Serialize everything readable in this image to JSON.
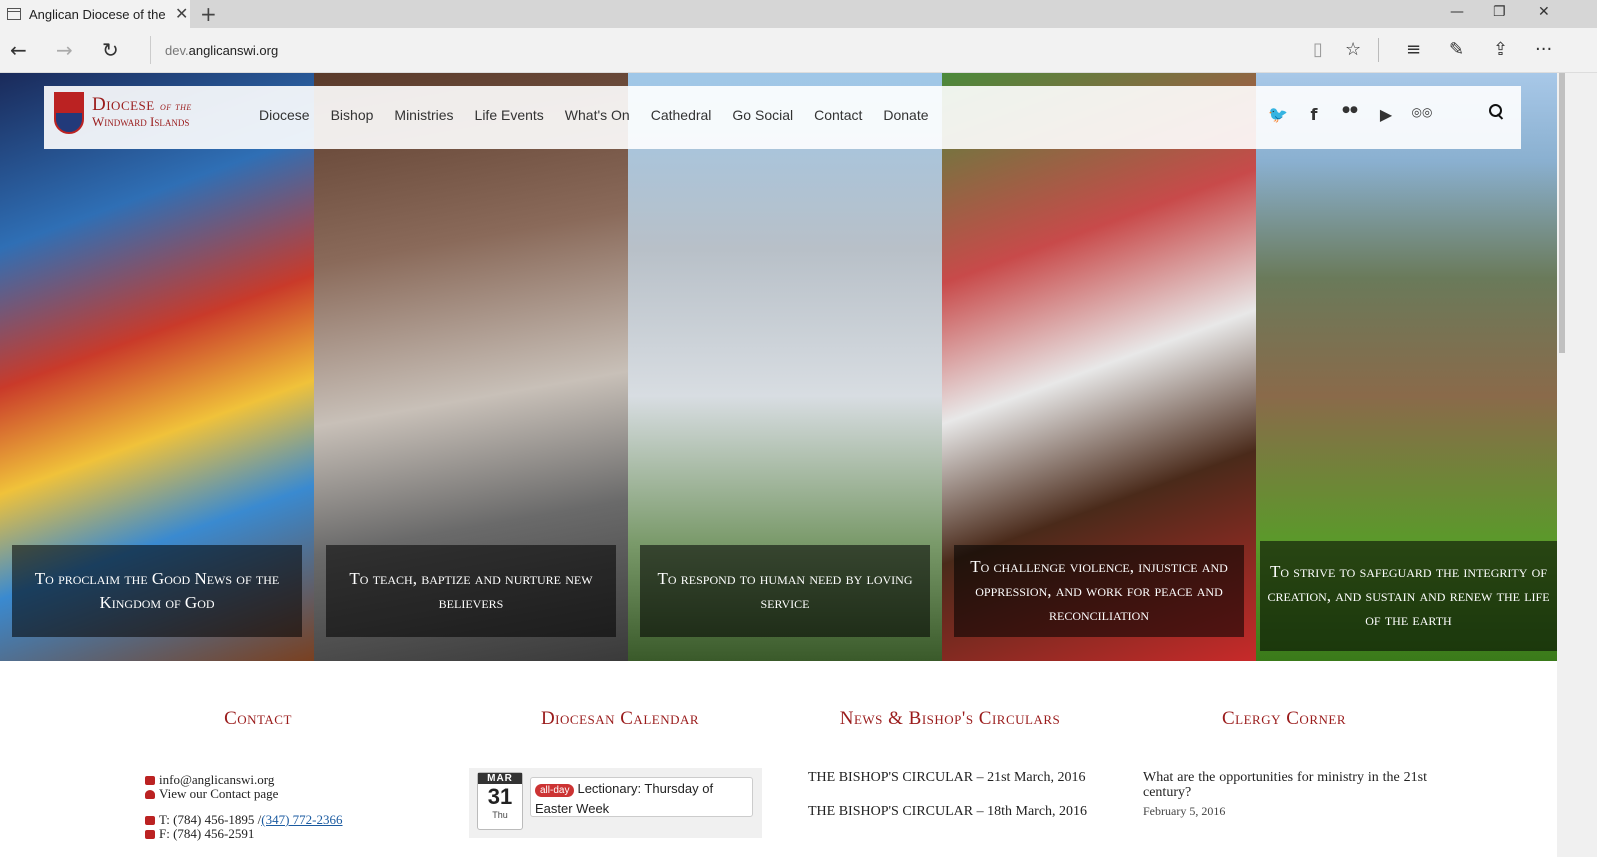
{
  "browser": {
    "tab_title": "Anglican Diocese of the",
    "tab_close": "✕",
    "new_tab": "+",
    "url_prefix": "dev.",
    "url_domain": "anglicanswi.org",
    "controls": {
      "minimize": "—",
      "restore": "❐",
      "close": "✕"
    },
    "nav": {
      "back": "←",
      "forward": "→",
      "refresh": "↻"
    },
    "toolbar": {
      "reading": "▯",
      "favorite": "☆",
      "hub": "≡",
      "note": "✎",
      "share": "⇪",
      "more": "···"
    }
  },
  "site": {
    "logo_line1": "Diocese",
    "logo_of": "of the",
    "logo_line2": "Windward Islands",
    "menu": [
      "Diocese",
      "Bishop",
      "Ministries",
      "Life Events",
      "What's On",
      "Cathedral",
      "Go Social",
      "Contact",
      "Donate"
    ],
    "social": {
      "twitter": "🐦",
      "facebook": "f",
      "flickr": "●●",
      "youtube": "▶",
      "tripadvisor": "◎◎"
    }
  },
  "hero": [
    {
      "caption": "To proclaim the Good News of the Kingdom of God"
    },
    {
      "caption": "To teach, baptize and nurture new believers"
    },
    {
      "caption": "To respond to human need by loving service"
    },
    {
      "caption": "To challenge violence, injustice and oppression, and work for peace and reconciliation"
    },
    {
      "caption": "To strive to safeguard the integrity of creation, and sustain and renew the life of the earth"
    }
  ],
  "sections": {
    "contact": {
      "heading": "Contact",
      "email": "info@anglicanswi.org",
      "contact_link": "View our Contact page",
      "phone_prefix": "T: (784) 456-1895 / ",
      "phone_link": "(347) 772-2366",
      "fax": "F: (784) 456-2591"
    },
    "calendar": {
      "heading": "Diocesan Calendar",
      "month": "MAR",
      "day": "31",
      "weekday": "Thu",
      "badge": "all-day",
      "event": "Lectionary: Thursday of Easter Week"
    },
    "news": {
      "heading": "News & Bishop's Circulars",
      "items": [
        "THE BISHOP'S CIRCULAR – 21st March, 2016",
        "THE BISHOP'S CIRCULAR – 18th March, 2016"
      ]
    },
    "clergy": {
      "heading": "Clergy Corner",
      "title": "What are the opportunities for ministry in the 21st century?",
      "date": "February 5, 2016"
    }
  }
}
